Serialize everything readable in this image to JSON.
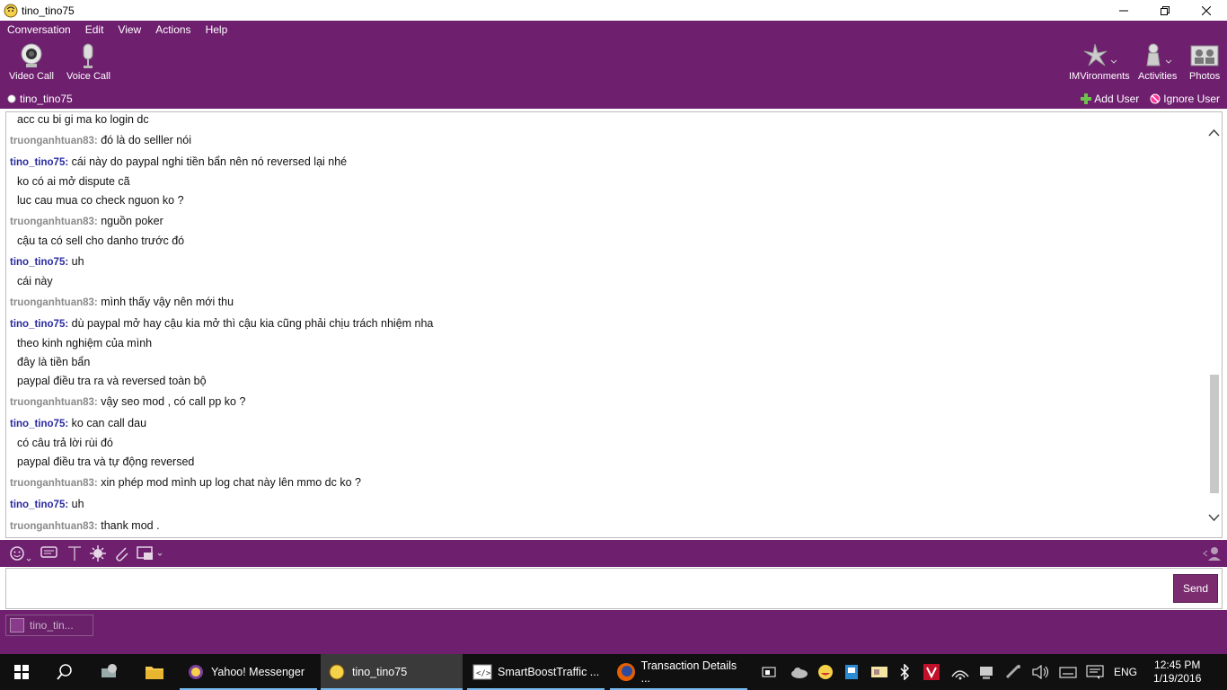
{
  "window": {
    "title": "tino_tino75"
  },
  "menu": [
    "Conversation",
    "Edit",
    "View",
    "Actions",
    "Help"
  ],
  "toolbar": {
    "video_call": "Video Call",
    "voice_call": "Voice Call",
    "imvironments": "IMVironments",
    "activities": "Activities",
    "photos": "Photos"
  },
  "userbar": {
    "contact": "tino_tino75",
    "add_user": "Add User",
    "ignore_user": "Ignore User"
  },
  "messages": [
    {
      "sender": "",
      "text": "acc cu bi gi ma ko login dc",
      "type": "cont"
    },
    {
      "sender": "truonganhtuan83:",
      "text": "đó là do selller nói",
      "type": "other"
    },
    {
      "sender": "tino_tino75:",
      "text": "cái này do paypal nghi tiền bẩn nên nó reversed lại nhé",
      "type": "self"
    },
    {
      "sender": "",
      "text": "ko có ai mở dispute cã",
      "type": "cont"
    },
    {
      "sender": "",
      "text": "luc cau mua co check nguon ko ?",
      "type": "cont"
    },
    {
      "sender": "truonganhtuan83:",
      "text": "nguồn poker",
      "type": "other"
    },
    {
      "sender": "",
      "text": "cậu ta có sell cho danho trước đó",
      "type": "cont"
    },
    {
      "sender": "tino_tino75:",
      "text": "uh",
      "type": "self"
    },
    {
      "sender": "",
      "text": "cái này",
      "type": "cont"
    },
    {
      "sender": "truonganhtuan83:",
      "text": "mình thấy vậy nên mới thu",
      "type": "other"
    },
    {
      "sender": "tino_tino75:",
      "text": "dù paypal mở hay cậu kia mở thì cậu kia cũng phải chịu trách nhiệm nha",
      "type": "self"
    },
    {
      "sender": "",
      "text": "theo kinh nghiệm của mình",
      "type": "cont"
    },
    {
      "sender": "",
      "text": "đây là tiền bẩn",
      "type": "cont"
    },
    {
      "sender": "",
      "text": "paypal điều tra ra và reversed toàn bộ",
      "type": "cont"
    },
    {
      "sender": "truonganhtuan83:",
      "text": "vậy seo mod , có call pp ko ?",
      "type": "other"
    },
    {
      "sender": "tino_tino75:",
      "text": "ko can call dau",
      "type": "self"
    },
    {
      "sender": "",
      "text": "có câu trả lời rùi đó",
      "type": "cont"
    },
    {
      "sender": "",
      "text": "paypal điều tra và tự động reversed",
      "type": "cont"
    },
    {
      "sender": "truonganhtuan83:",
      "text": "xin phép mod mình up log chat này lên mmo dc ko ?",
      "type": "other"
    },
    {
      "sender": "tino_tino75:",
      "text": "uh",
      "type": "self"
    },
    {
      "sender": "truonganhtuan83:",
      "text": "thank mod .",
      "type": "other"
    }
  ],
  "input": {
    "send_label": "Send",
    "value": ""
  },
  "conversation_tab": {
    "label": "tino_tin..."
  },
  "taskbar": {
    "apps": [
      "Yahoo! Messenger",
      "tino_tino75",
      "SmartBoostTraffic ...",
      "Transaction Details ..."
    ],
    "language": "ENG",
    "time": "12:45 PM",
    "date": "1/19/2016"
  },
  "colors": {
    "purple": "#6e1f6e",
    "self_name": "#2a2aa0",
    "other_name": "#8a8a8a"
  }
}
